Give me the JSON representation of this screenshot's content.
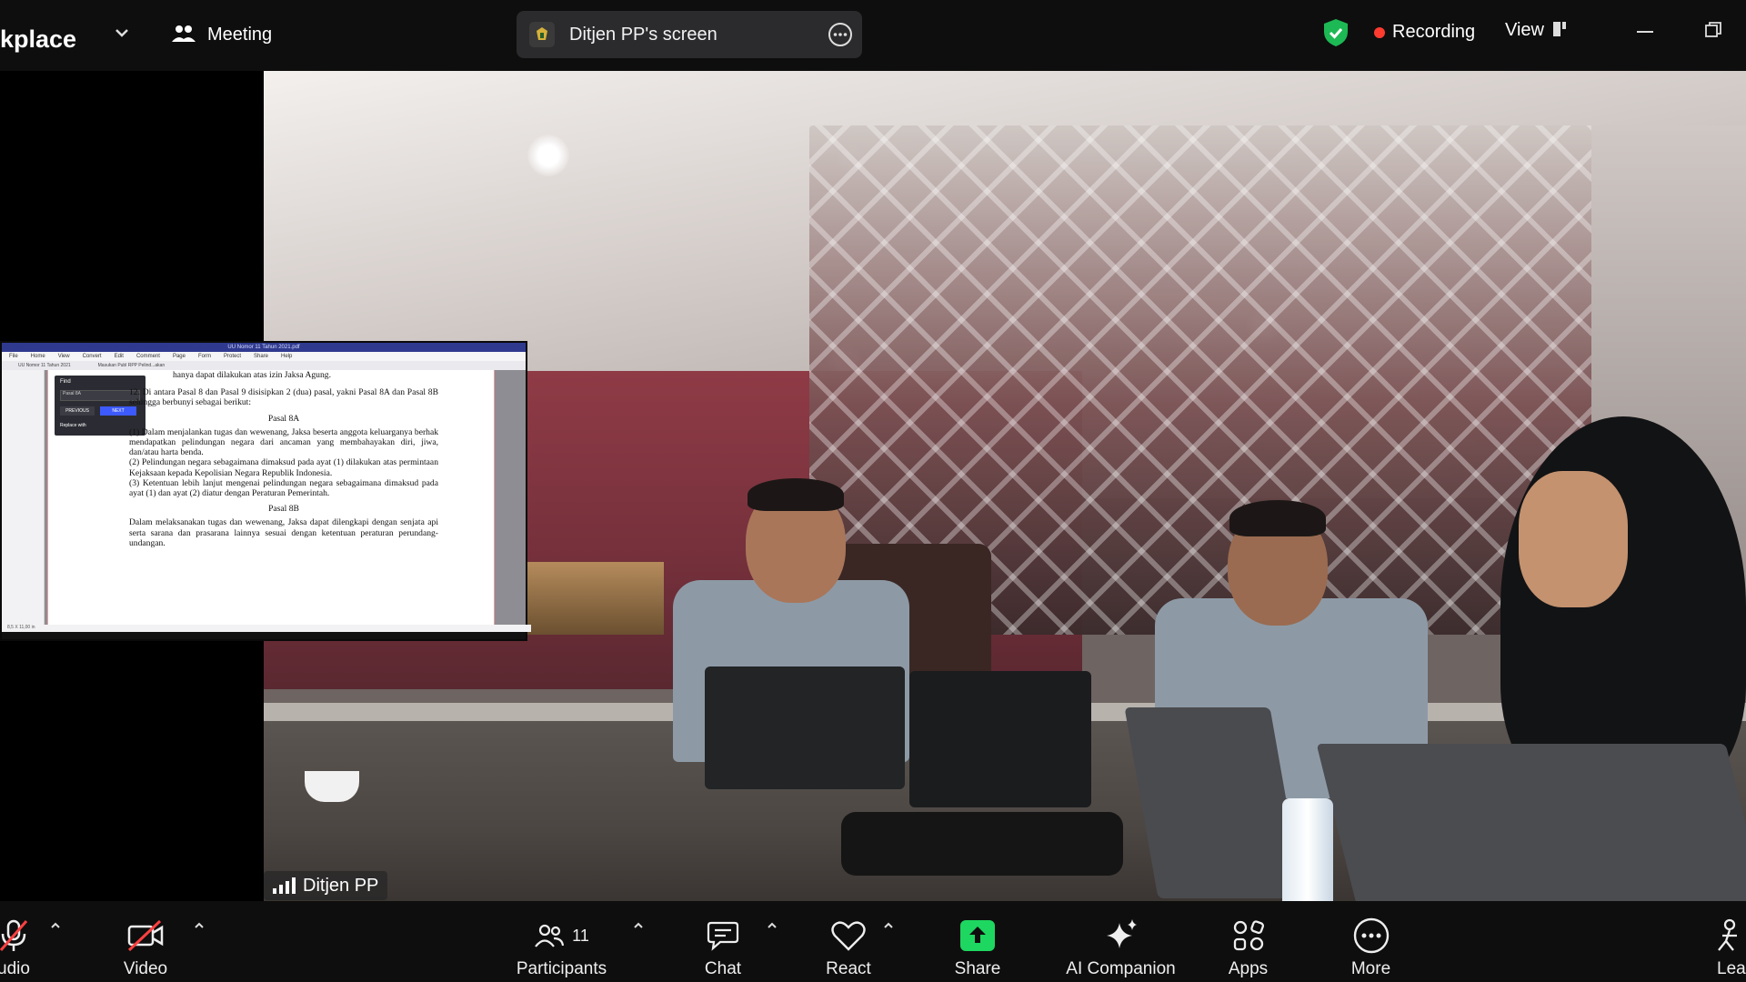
{
  "topbar": {
    "app_name": "kplace",
    "meeting_label": "Meeting",
    "screen_share_label": "Ditjen PP's screen",
    "recording_label": "Recording",
    "view_label": "View"
  },
  "colors": {
    "background": "#0e0e0e",
    "recording": "#ff3b30",
    "security_shield": "#1db954",
    "share_button": "#1ed760",
    "next_button": "#3d5afe"
  },
  "video": {
    "participant_name": "Ditjen PP"
  },
  "shared_document": {
    "title_bar": "UU Nomor 11 Tahun 2021.pdf",
    "menu": [
      "File",
      "Home",
      "View",
      "Convert",
      "Edit",
      "Comment",
      "Page",
      "Form",
      "Protect",
      "Share",
      "Help"
    ],
    "tabs": [
      "UU Nomor 11 Tahun 2021",
      "Masukan Publ RPP Pelind...akan"
    ],
    "find_panel": {
      "title": "Find",
      "input_value": "Pasal 8A",
      "previous_label": "PREVIOUS",
      "next_label": "NEXT",
      "replace_label": "Replace with"
    },
    "text": {
      "line0": "hanya dapat dilakukan atas izin Jaksa Agung.",
      "item12": "12. Di antara Pasal 8 dan Pasal 9 disisipkan 2 (dua) pasal, yakni Pasal 8A dan Pasal 8B sehingga berbunyi sebagai berikut:",
      "pasal8a": "Pasal 8A",
      "p1": "(1) Dalam menjalankan tugas dan wewenang, Jaksa beserta anggota keluarganya berhak mendapatkan pelindungan negara dari ancaman yang membahayakan diri, jiwa, dan/atau harta benda.",
      "p2": "(2) Pelindungan negara sebagaimana dimaksud pada ayat (1) dilakukan atas permintaan Kejaksaan kepada Kepolisian Negara Republik Indonesia.",
      "p3": "(3) Ketentuan lebih lanjut mengenai pelindungan negara sebagaimana dimaksud pada ayat (1) dan ayat (2) diatur dengan Peraturan Pemerintah.",
      "pasal8b": "Pasal 8B",
      "p8b": "Dalam melaksanakan tugas dan wewenang, Jaksa dapat dilengkapi dengan senjata api serta sarana dan prasarana lainnya sesuai dengan ketentuan peraturan perundang-undangan."
    },
    "status": "8,5 X 11,00 in"
  },
  "bottombar": {
    "audio_label": "udio",
    "video_label": "Video",
    "participants_label": "Participants",
    "participants_count": "11",
    "chat_label": "Chat",
    "react_label": "React",
    "share_label": "Share",
    "ai_label": "AI Companion",
    "apps_label": "Apps",
    "more_label": "More",
    "leave_label": "Lea"
  },
  "icons": [
    "chevron-down-icon",
    "participants-icon",
    "more-icon",
    "shield-icon",
    "record-dot-icon",
    "view-icon",
    "minimize-icon",
    "restore-icon",
    "signal-bars-icon",
    "microphone-muted-icon",
    "video-muted-icon",
    "participants-icon",
    "chat-icon",
    "heart-icon",
    "share-arrow-icon",
    "sparkle-icon",
    "apps-icon",
    "more-circle-icon",
    "leave-icon"
  ]
}
